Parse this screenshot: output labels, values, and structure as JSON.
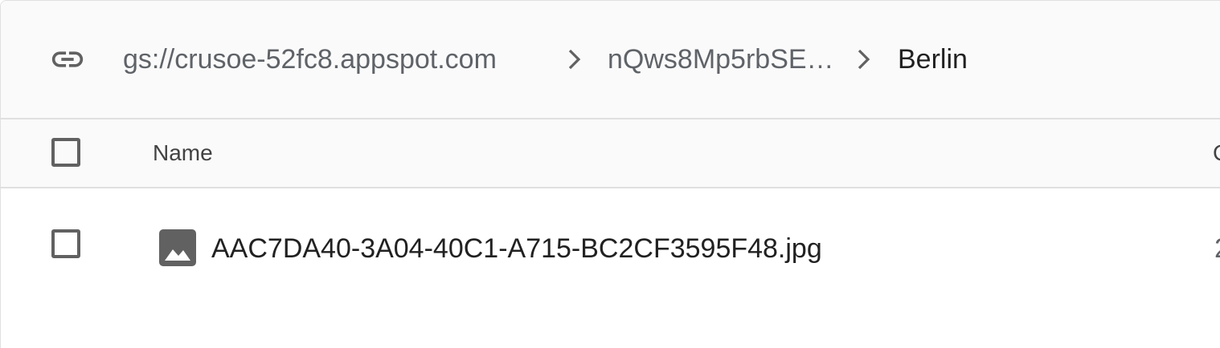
{
  "breadcrumb": {
    "icon": "link-icon",
    "items": [
      {
        "label": "gs://crusoe-52fc8.appspot.com"
      },
      {
        "label": "nQws8Mp5rbSE…"
      },
      {
        "label": "Berlin"
      }
    ],
    "separator_icon": "chevron-right-icon"
  },
  "table": {
    "columns": [
      {
        "label": "Name"
      },
      {
        "label": "C"
      }
    ],
    "rows": [
      {
        "icon": "image-file-icon",
        "name": "AAC7DA40-3A04-40C1-A715-BC2CF3595F48.jpg",
        "next_col_value": "2"
      }
    ]
  },
  "colors": {
    "header_bg": "#fafafa",
    "border": "#e0e0e0",
    "text_primary": "#212121",
    "text_secondary": "#5f6368",
    "icon": "#616161"
  }
}
